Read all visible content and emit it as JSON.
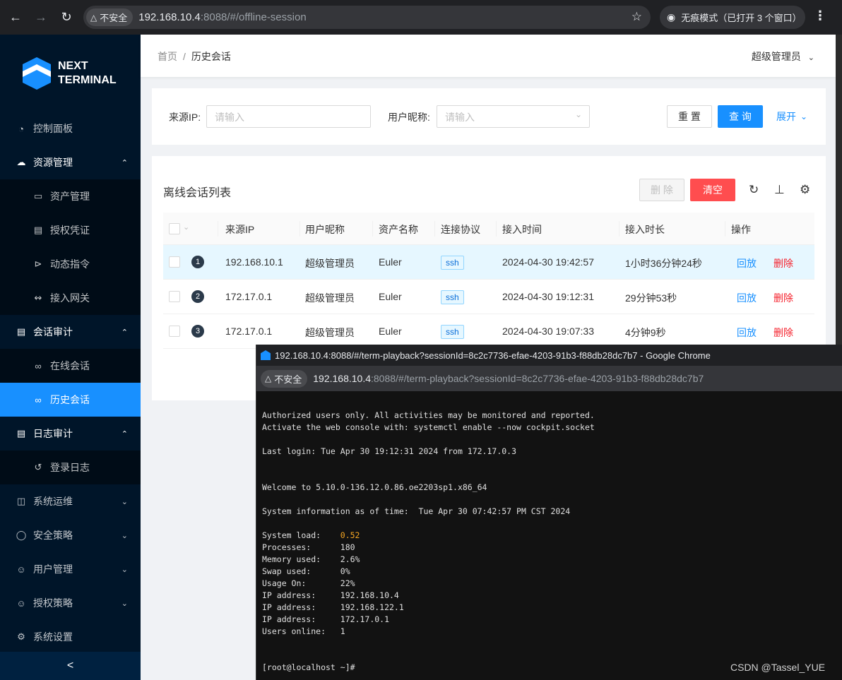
{
  "browser": {
    "security_label": "不安全",
    "url_host": "192.168.10.4",
    "url_rest": ":8088/#/offline-session",
    "incognito_label": "无痕模式（已打开 3 个窗口）"
  },
  "sidebar": {
    "logo_line1": "NEXT",
    "logo_line2": "TERMINAL",
    "items": [
      {
        "label": "控制面板",
        "icon": "dashboard-icon"
      },
      {
        "label": "资源管理",
        "icon": "cloud-icon"
      },
      {
        "label": "资产管理",
        "icon": "desktop-icon"
      },
      {
        "label": "授权凭证",
        "icon": "idcard-icon"
      },
      {
        "label": "动态指令",
        "icon": "code-icon"
      },
      {
        "label": "接入网关",
        "icon": "api-icon"
      },
      {
        "label": "会话审计",
        "icon": "audit-icon"
      },
      {
        "label": "在线会话",
        "icon": "link-icon"
      },
      {
        "label": "历史会话",
        "icon": "disconnect-icon"
      },
      {
        "label": "日志审计",
        "icon": "audit-icon"
      },
      {
        "label": "登录日志",
        "icon": "login-icon"
      },
      {
        "label": "系统运维",
        "icon": "control-icon"
      },
      {
        "label": "安全策略",
        "icon": "safety-icon"
      },
      {
        "label": "用户管理",
        "icon": "user-icon"
      },
      {
        "label": "授权策略",
        "icon": "user-icon"
      },
      {
        "label": "系统设置",
        "icon": "setting-icon"
      }
    ],
    "collapse": "<"
  },
  "header": {
    "breadcrumb_home": "首页",
    "breadcrumb_sep": "/",
    "breadcrumb_current": "历史会话",
    "user": "超级管理员"
  },
  "search": {
    "source_ip_label": "来源IP:",
    "source_ip_placeholder": "请输入",
    "nickname_label": "用户昵称:",
    "nickname_placeholder": "请输入",
    "reset": "重 置",
    "query": "查 询",
    "expand": "展开"
  },
  "table": {
    "title": "离线会话列表",
    "delete_btn": "删 除",
    "clear_btn": "清空",
    "columns": [
      "来源IP",
      "用户昵称",
      "资产名称",
      "连接协议",
      "接入时间",
      "接入时长",
      "操作"
    ],
    "rows": [
      {
        "idx": "1",
        "ip": "192.168.10.1",
        "user": "超级管理员",
        "asset": "Euler",
        "protocol": "ssh",
        "time": "2024-04-30 19:42:57",
        "duration": "1小时36分钟24秒",
        "play": "回放",
        "del": "删除"
      },
      {
        "idx": "2",
        "ip": "172.17.0.1",
        "user": "超级管理员",
        "asset": "Euler",
        "protocol": "ssh",
        "time": "2024-04-30 19:12:31",
        "duration": "29分钟53秒",
        "play": "回放",
        "del": "删除"
      },
      {
        "idx": "3",
        "ip": "172.17.0.1",
        "user": "超级管理员",
        "asset": "Euler",
        "protocol": "ssh",
        "time": "2024-04-30 19:07:33",
        "duration": "4分钟9秒",
        "play": "回放",
        "del": "删除"
      }
    ]
  },
  "popup": {
    "title": "192.168.10.4:8088/#/term-playback?sessionId=8c2c7736-efae-4203-91b3-f88db28dc7b7 - Google Chrome",
    "security_label": "不安全",
    "url_host": "192.168.10.4",
    "url_rest": ":8088/#/term-playback?sessionId=8c2c7736-efae-4203-91b3-f88db28dc7b7",
    "terminal_lines": [
      "Authorized users only. All activities may be monitored and reported.",
      "Activate the web console with: systemctl enable --now cockpit.socket",
      "",
      "Last login: Tue Apr 30 19:12:31 2024 from 172.17.0.3",
      "",
      "",
      "Welcome to 5.10.0-136.12.0.86.oe2203sp1.x86_64",
      "",
      "System information as of time:  Tue Apr 30 07:42:57 PM CST 2024",
      "",
      "System load:    0.52",
      "Processes:      180",
      "Memory used:    2.6%",
      "Swap used:      0%",
      "Usage On:       22%",
      "IP address:     192.168.10.4",
      "IP address:     192.168.122.1",
      "IP address:     172.17.0.1",
      "Users online:   1",
      "",
      "",
      "[root@localhost ~]#"
    ]
  },
  "watermark": "CSDN @Tassel_YUE"
}
